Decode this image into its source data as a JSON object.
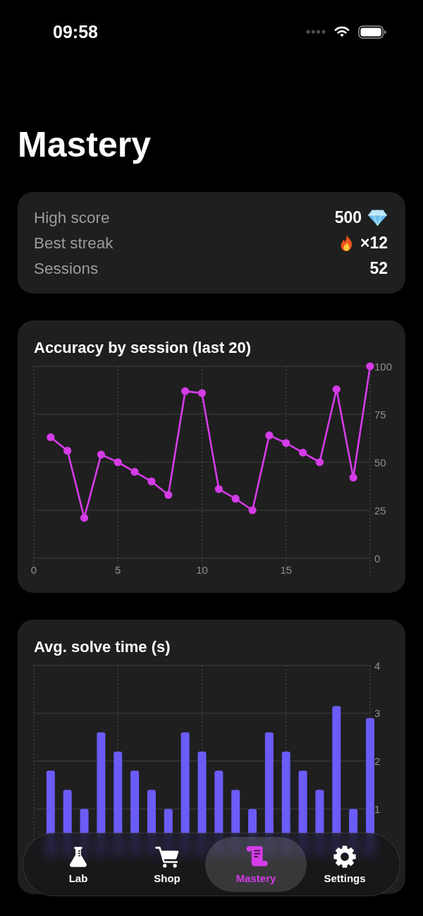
{
  "status_bar": {
    "time": "09:58"
  },
  "title": "Mastery",
  "stats": [
    {
      "kind": "score",
      "label": "High score",
      "value": "500"
    },
    {
      "kind": "streak",
      "label": "Best streak",
      "value": "×12"
    },
    {
      "kind": "count",
      "label": "Sessions",
      "value": "52"
    }
  ],
  "accuracy_card": {
    "chart_data": {
      "type": "line",
      "title": "Accuracy by session (last 20)",
      "x": [
        1,
        2,
        3,
        4,
        5,
        6,
        7,
        8,
        9,
        10,
        11,
        12,
        13,
        14,
        15,
        16,
        17,
        18,
        19,
        20
      ],
      "series": [
        {
          "color": "#d43ce8",
          "marker": true,
          "values": [
            63,
            56,
            21,
            54,
            50,
            45,
            40,
            33,
            87,
            86,
            36,
            31,
            25,
            64,
            60,
            55,
            50,
            88,
            42,
            100
          ]
        }
      ],
      "xlim": [
        0,
        20
      ],
      "ylim": [
        0,
        100
      ],
      "xticks": [
        0,
        5,
        10,
        15
      ],
      "yticks": [
        0,
        25,
        50,
        75,
        100
      ],
      "grid": true
    }
  },
  "solve_time_card": {
    "chart_data": {
      "type": "bar",
      "title": "Avg. solve time (s)",
      "x": [
        1,
        2,
        3,
        4,
        5,
        6,
        7,
        8,
        9,
        10,
        11,
        12,
        13,
        14,
        15,
        16,
        17,
        18,
        19,
        20
      ],
      "series": [
        {
          "color": "#6b5cfa",
          "values": [
            1.8,
            1.4,
            1.0,
            2.6,
            2.2,
            1.8,
            1.4,
            1.0,
            2.6,
            2.2,
            1.8,
            1.4,
            1.0,
            2.6,
            2.2,
            1.8,
            1.4,
            3.15,
            1.0,
            2.9
          ]
        }
      ],
      "xlim": [
        0,
        20
      ],
      "ylim": [
        0,
        4
      ],
      "yticks": [
        1,
        2,
        3,
        4
      ],
      "grid": true
    }
  },
  "tabs": [
    {
      "label": "Lab",
      "selected": false
    },
    {
      "label": "Shop",
      "selected": false
    },
    {
      "label": "Mastery",
      "selected": true
    },
    {
      "label": "Settings",
      "selected": false
    }
  ]
}
